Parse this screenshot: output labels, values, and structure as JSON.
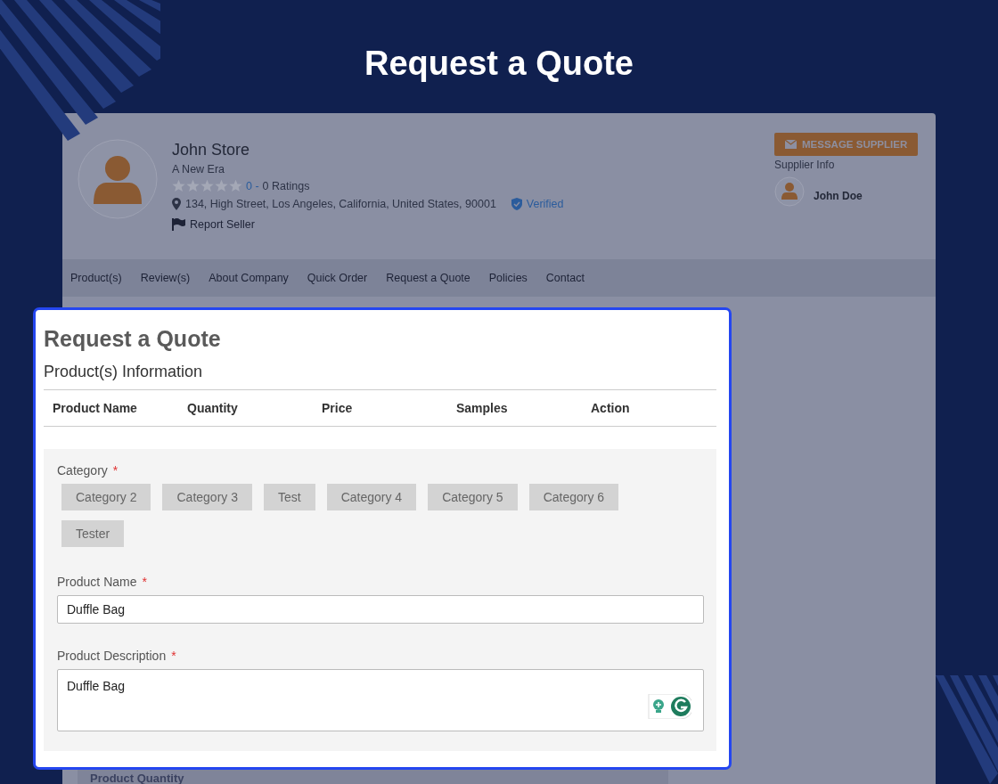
{
  "page_title": "Request a Quote",
  "store": {
    "name": "John Store",
    "tagline": "A New Era",
    "stars": 0,
    "rating_value": "0 -",
    "rating_count": "0 Ratings",
    "address": "134, High Street, Los Angeles, California, United States, 90001",
    "verified": "Verified",
    "report": "Report Seller"
  },
  "supplier": {
    "button": "MESSAGE SUPPLIER",
    "label": "Supplier Info",
    "name": "John Doe"
  },
  "nav": [
    "Product(s)",
    "Review(s)",
    "About Company",
    "Quick Order",
    "Request a Quote",
    "Policies",
    "Contact"
  ],
  "behind_label": "Product Quantity",
  "dialog": {
    "title": "Request a Quote",
    "section": "Product(s) Information",
    "columns": [
      "Product Name",
      "Quantity",
      "Price",
      "Samples",
      "Action"
    ],
    "category": {
      "label": "Category",
      "required_mark": "*",
      "chips": [
        {
          "label": "Category 2",
          "selected": false
        },
        {
          "label": "Category 3",
          "selected": false
        },
        {
          "label": "Test",
          "selected": false
        },
        {
          "label": "Category 4",
          "selected": false
        },
        {
          "label": "Category 5",
          "selected": false
        },
        {
          "label": "Category 6",
          "selected": false
        },
        {
          "label": "Tester",
          "selected": false
        }
      ]
    },
    "fields": [
      {
        "kind": "input",
        "label": "Product Name",
        "required_mark": "*",
        "value": "Duffle Bag"
      },
      {
        "kind": "textarea",
        "label": "Product Description",
        "required_mark": "*",
        "value": "Duffle Bag"
      }
    ]
  }
}
